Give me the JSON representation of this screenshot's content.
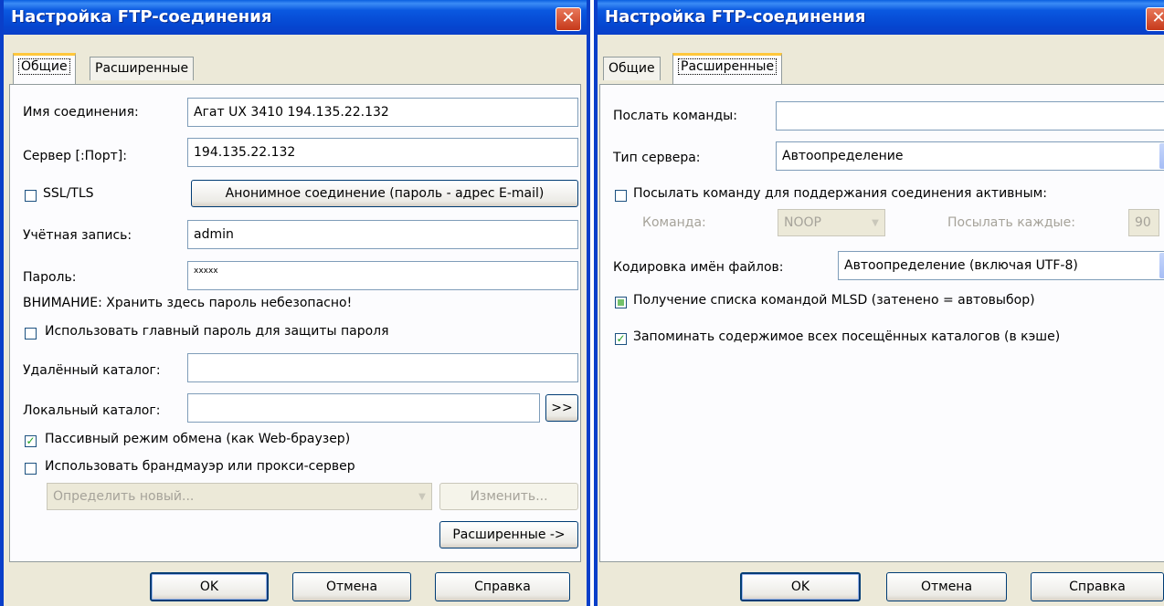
{
  "left": {
    "title": "Настройка FTP-соединения",
    "close_glyph": "✕",
    "tabs": {
      "general": "Общие",
      "advanced": "Расширенные"
    },
    "fields": {
      "name_label": "Имя соединения:",
      "name_value": "Агат UX 3410 194.135.22.132",
      "server_label": "Сервер [:Порт]:",
      "server_value": "194.135.22.132",
      "ssl_label": "SSL/TLS",
      "anon_button": "Анонимное соединение (пароль - адрес E-mail)",
      "account_label": "Учётная запись:",
      "account_value": "admin",
      "password_label": "Пароль:",
      "password_value": "xxxxx",
      "warning": "ВНИМАНИЕ: Хранить здесь пароль небезопасно!",
      "master_pw_label": "Использовать главный пароль для защиты пароля",
      "remote_dir_label": "Удалённый каталог:",
      "remote_dir_value": "",
      "local_dir_label": "Локальный каталог:",
      "local_dir_value": "",
      "browse_button": ">>",
      "passive_label": "Пассивный режим обмена (как Web-браузер)",
      "firewall_label": "Использовать брандмауэр или прокси-сервер",
      "proxy_select": "Определить новый...",
      "change_button": "Изменить...",
      "advanced_button": "Расширенные ->"
    },
    "buttons": {
      "ok": "OK",
      "cancel": "Отмена",
      "help": "Справка"
    }
  },
  "right": {
    "title": "Настройка FTP-соединения",
    "close_glyph": "✕",
    "tabs": {
      "general": "Общие",
      "advanced": "Расширенные"
    },
    "fields": {
      "send_cmd_label": "Послать команды:",
      "send_cmd_value": "",
      "server_type_label": "Тип сервера:",
      "server_type_value": "Автоопределение",
      "keepalive_label": "Посылать команду для поддержания соединения активным:",
      "command_label": "Команда:",
      "command_value": "NOOP",
      "interval_label": "Посылать каждые:",
      "interval_value": "90",
      "encoding_label": "Кодировка имён файлов:",
      "encoding_value": "Автоопределение (включая UTF-8)",
      "mlsd_label": "Получение списка командой MLSD (затенено = автовыбор)",
      "cache_label": "Запоминать содержимое всех посещённых каталогов (в кэше)"
    },
    "buttons": {
      "ok": "OK",
      "cancel": "Отмена",
      "help": "Справка"
    }
  },
  "colors": {
    "title_bar": "#0a58e0",
    "dialog_bg": "#ece9d8",
    "tab_highlight": "#ffc73c",
    "annotation_red": "#e61c1c"
  }
}
